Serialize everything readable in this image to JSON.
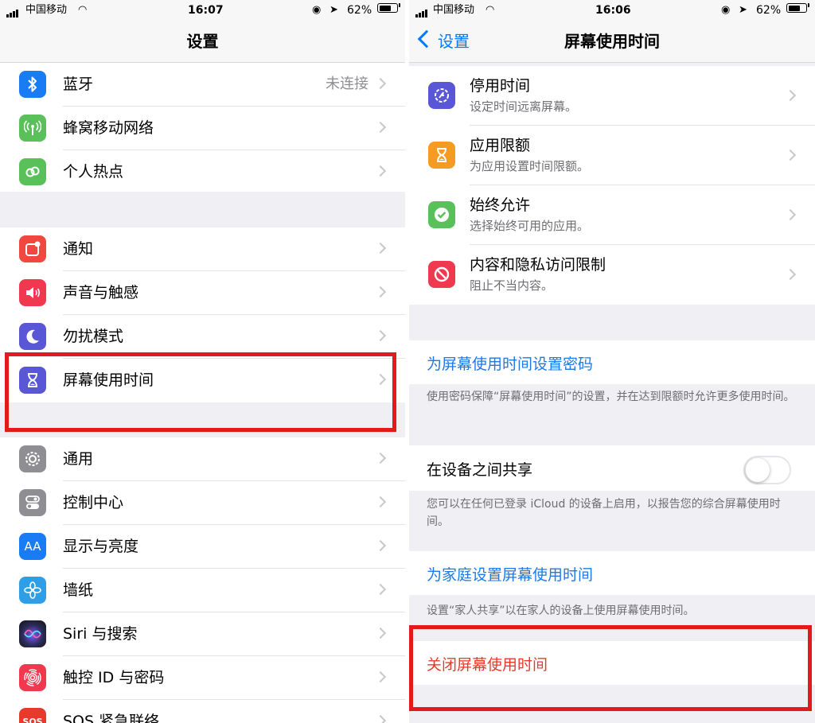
{
  "left_screen": {
    "status_bar": {
      "carrier": "中国移动",
      "time": "16:07",
      "battery": "62%",
      "battery_level": 0.62
    },
    "nav_title": "设置",
    "group1": [
      {
        "label": "蓝牙",
        "value": "未连接",
        "icon": "bluetooth-icon",
        "color": "#1a7cf5"
      },
      {
        "label": "蜂窝移动网络",
        "icon": "cellular-icon",
        "color": "#5ac15a"
      },
      {
        "label": "个人热点",
        "icon": "hotspot-icon",
        "color": "#5ac15a"
      }
    ],
    "group2": [
      {
        "label": "通知",
        "icon": "notifications-icon",
        "color": "#f0473e"
      },
      {
        "label": "声音与触感",
        "icon": "sound-icon",
        "color": "#f0384f"
      },
      {
        "label": "勿扰模式",
        "icon": "moon-icon",
        "color": "#5a57d6"
      },
      {
        "label": "屏幕使用时间",
        "icon": "hourglass-icon",
        "color": "#5a57d6"
      }
    ],
    "group3": [
      {
        "label": "通用",
        "icon": "gear-icon",
        "color": "#8e8e93"
      },
      {
        "label": "控制中心",
        "icon": "switches-icon",
        "color": "#8e8e93"
      },
      {
        "label": "显示与亮度",
        "icon_text": "AA",
        "icon": "display-icon",
        "color": "#1a7cf5"
      },
      {
        "label": "墙纸",
        "icon": "wallpaper-icon",
        "color": "#2e9ee8"
      },
      {
        "label": "Siri 与搜索",
        "icon": "siri-icon",
        "color": "#222233"
      },
      {
        "label": "触控 ID 与密码",
        "icon": "fingerprint-icon",
        "color": "#f0384f"
      },
      {
        "label": "SOS 紧急联络",
        "icon": "sos-icon",
        "color": "#e8392b"
      }
    ]
  },
  "right_screen": {
    "status_bar": {
      "carrier": "中国移动",
      "time": "16:06",
      "battery": "62%",
      "battery_level": 0.62
    },
    "nav_back": "设置",
    "nav_title": "屏幕使用时间",
    "options": [
      {
        "title": "停用时间",
        "subtitle": "设定时间远离屏幕。",
        "icon": "downtime-icon",
        "color": "#5a57d6"
      },
      {
        "title": "应用限额",
        "subtitle": "为应用设置时间限额。",
        "icon": "hourglass-icon",
        "color": "#f59a23"
      },
      {
        "title": "始终允许",
        "subtitle": "选择始终可用的应用。",
        "icon": "checkmark-badge-icon",
        "color": "#5ac15a"
      },
      {
        "title": "内容和隐私访问限制",
        "subtitle": "阻止不当内容。",
        "icon": "restriction-icon",
        "color": "#f0384f"
      }
    ],
    "passcode_link": "为屏幕使用时间设置密码",
    "passcode_footer": "使用密码保障“屏幕使用时间”的设置，并在达到限额时允许更多使用时间。",
    "share_label": "在设备之间共享",
    "share_on": false,
    "share_footer": "您可以在任何已登录 iCloud 的设备上启用，以报告您的综合屏幕使用时间。",
    "family_link": "为家庭设置屏幕使用时间",
    "family_footer": "设置“家人共享”以在家人的设备上使用屏幕使用时间。",
    "turn_off": "关闭屏幕使用时间"
  },
  "colors": {
    "highlight": "#e3191b",
    "link": "#1e78e6",
    "destructive": "#e8392b"
  }
}
